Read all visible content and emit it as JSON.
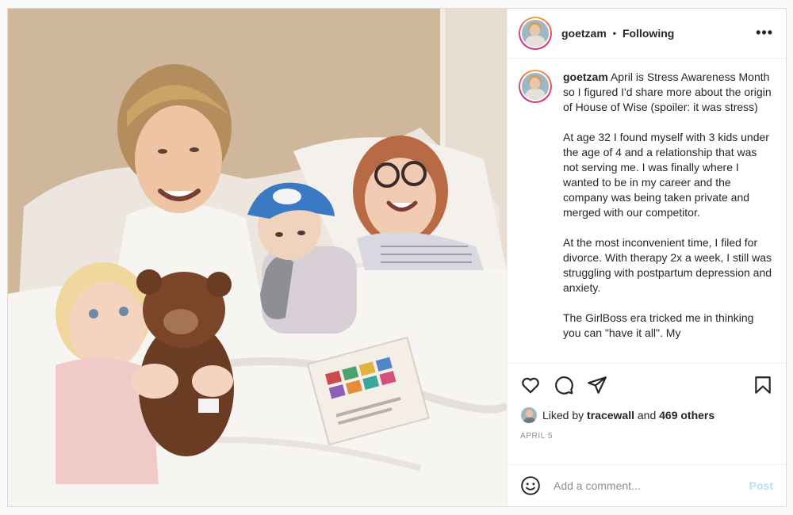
{
  "post": {
    "photo_icon": "family-photo",
    "username": "goetzam",
    "separator": "•",
    "follow_status": "Following",
    "more_label": "•••",
    "caption_paragraphs": [
      "April is Stress Awareness Month so I figured I'd share more about the origin of House of Wise (spoiler: it was stress)",
      "At age 32 I found myself with 3 kids under the age of 4 and a relationship that was not serving me. I was finally where I wanted to be in my career and the company was being taken private and merged with our competitor.",
      "At the most inconvenient time, I filed for divorce. With therapy 2x a week, I still was struggling with postpartum depression and anxiety.",
      "The GirlBoss era tricked me in thinking you can \"have it all\". My"
    ],
    "likes": {
      "prefix": "Liked by",
      "liker": "tracewall",
      "joiner": "and",
      "others": "469 others"
    },
    "date": "APRIL 5",
    "comment": {
      "placeholder": "Add a comment...",
      "post_label": "Post"
    },
    "icons": [
      "heart-icon",
      "comment-icon",
      "share-icon",
      "bookmark-icon",
      "emoji-icon",
      "more-icon"
    ],
    "colors": {
      "post_button": "#b2dffc",
      "avatar_ring": "#e1306c",
      "text": "#262626",
      "muted": "#8e8e8e"
    }
  }
}
